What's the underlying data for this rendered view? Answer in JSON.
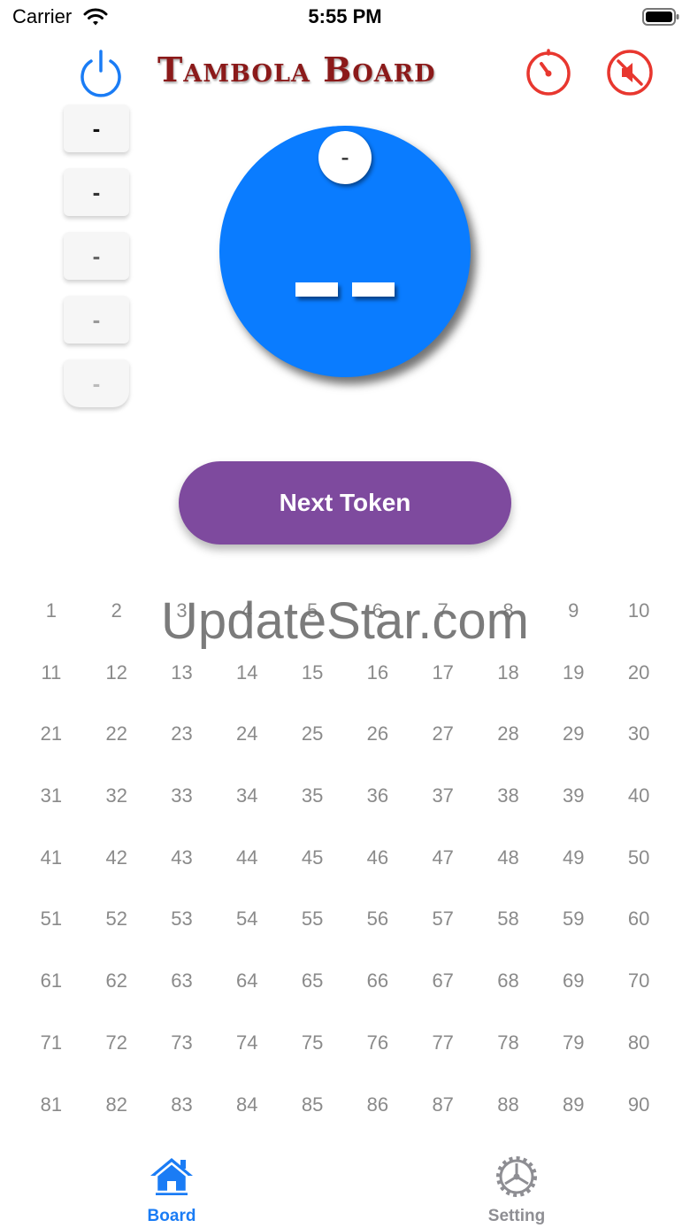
{
  "status": {
    "carrier": "Carrier",
    "time": "5:55 PM"
  },
  "header": {
    "title": "Tambola Board",
    "power_icon": "power-icon",
    "timer_icon": "timer-icon",
    "mute_icon": "mute-icon",
    "accent_blue": "#0a7cff",
    "accent_red": "#e8372f"
  },
  "history": [
    "-",
    "-",
    "-",
    "-",
    "-"
  ],
  "ball": {
    "badge": "-",
    "number": "--",
    "color": "#0a7cff"
  },
  "next_button": {
    "label": "Next Token",
    "color": "#7e4a9e"
  },
  "board": {
    "rows": [
      [
        "1",
        "2",
        "3",
        "4",
        "5",
        "6",
        "7",
        "8",
        "9",
        "10"
      ],
      [
        "11",
        "12",
        "13",
        "14",
        "15",
        "16",
        "17",
        "18",
        "19",
        "20"
      ],
      [
        "21",
        "22",
        "23",
        "24",
        "25",
        "26",
        "27",
        "28",
        "29",
        "30"
      ],
      [
        "31",
        "32",
        "33",
        "34",
        "35",
        "36",
        "37",
        "38",
        "39",
        "40"
      ],
      [
        "41",
        "42",
        "43",
        "44",
        "45",
        "46",
        "47",
        "48",
        "49",
        "50"
      ],
      [
        "51",
        "52",
        "53",
        "54",
        "55",
        "56",
        "57",
        "58",
        "59",
        "60"
      ],
      [
        "61",
        "62",
        "63",
        "64",
        "65",
        "66",
        "67",
        "68",
        "69",
        "70"
      ],
      [
        "71",
        "72",
        "73",
        "74",
        "75",
        "76",
        "77",
        "78",
        "79",
        "80"
      ],
      [
        "81",
        "82",
        "83",
        "84",
        "85",
        "86",
        "87",
        "88",
        "89",
        "90"
      ]
    ]
  },
  "watermark": "UpdateStar.com",
  "tabs": [
    {
      "label": "Board",
      "icon": "home-icon",
      "active": true
    },
    {
      "label": "Setting",
      "icon": "gear-icon",
      "active": false
    }
  ]
}
